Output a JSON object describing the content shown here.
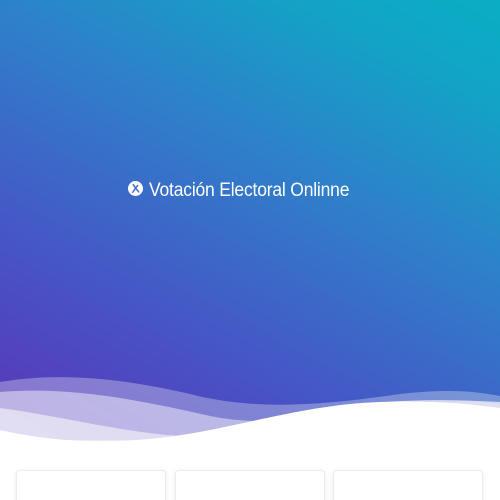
{
  "header": {
    "title": "Votación Electoral Onlinne",
    "logo_icon": "vote-logo-icon"
  },
  "colors": {
    "gradient_start": "#5b34b8",
    "gradient_end": "#0aaec4",
    "title_text": "#ffffff"
  },
  "cards": [
    {
      "id": "card-1"
    },
    {
      "id": "card-2"
    },
    {
      "id": "card-3"
    }
  ]
}
